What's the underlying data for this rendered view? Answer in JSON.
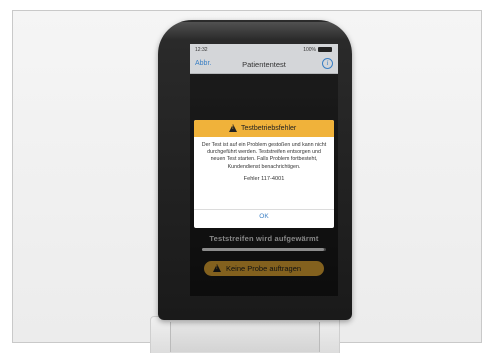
{
  "statusbar": {
    "time": "12:32",
    "battery_text": "100%",
    "battery_icon": "battery-icon"
  },
  "navbar": {
    "cancel_label": "Abbr.",
    "title": "Patiententest",
    "info_icon": "info-icon",
    "info_glyph": "i"
  },
  "dialog": {
    "title": "Testbetriebsfehler",
    "icon": "warning-icon",
    "message": "Der Test ist auf ein Problem gestoßen und kann nicht durchgeführt werden. Teststreifen entsorgen und neuen Test starten. Falls Problem fortbesteht, Kundendienst benachrichtigen.",
    "error_code": "Fehler 117-4001",
    "ok_label": "OK"
  },
  "main": {
    "status_text": "Teststreifen wird aufgewärmt",
    "progress": 0.98,
    "apply_button_label": "Keine Probe auftragen",
    "apply_button_icon": "warning-icon"
  },
  "colors": {
    "warning_header": "#f0b23a",
    "accent_blue": "#3a7fc4",
    "button_amber": "#c9962e"
  }
}
